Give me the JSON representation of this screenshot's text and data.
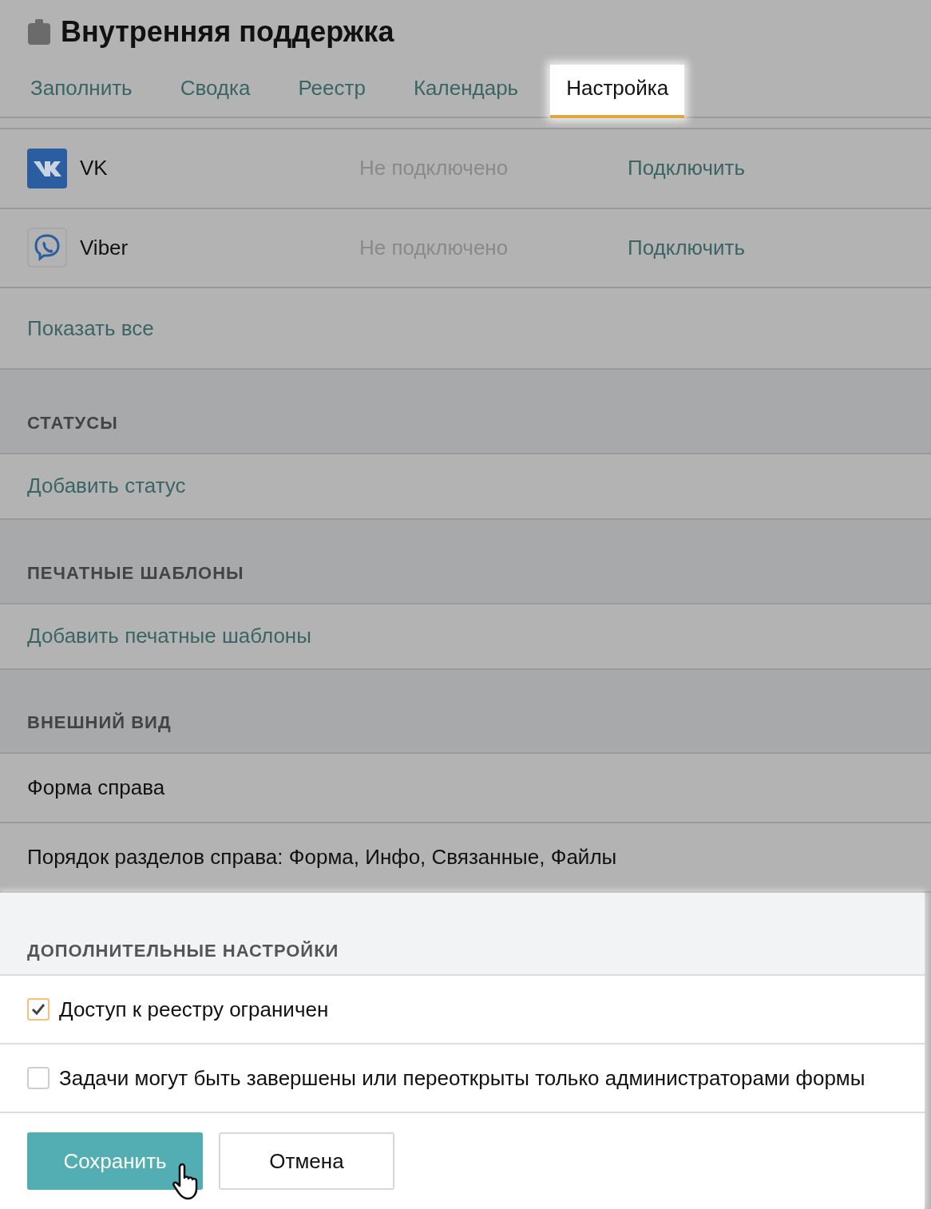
{
  "header": {
    "title": "Внутренняя поддержка"
  },
  "tabs": [
    {
      "label": "Заполнить",
      "selected": false
    },
    {
      "label": "Сводка",
      "selected": false
    },
    {
      "label": "Реестр",
      "selected": false
    },
    {
      "label": "Календарь",
      "selected": false
    },
    {
      "label": "Настройка",
      "selected": true
    }
  ],
  "integrations": [
    {
      "kind": "vk",
      "name": "VK",
      "status": "Не подключено",
      "action": "Подключить"
    },
    {
      "kind": "viber",
      "name": "Viber",
      "status": "Не подключено",
      "action": "Подключить"
    }
  ],
  "show_all": "Показать все",
  "sections": [
    {
      "title": "СТАТУСЫ",
      "items": [
        {
          "kind": "link",
          "text": "Добавить статус"
        }
      ]
    },
    {
      "title": "ПЕЧАТНЫЕ ШАБЛОНЫ",
      "items": [
        {
          "kind": "link",
          "text": "Добавить печатные шаблоны"
        }
      ]
    },
    {
      "title": "ВНЕШНИЙ ВИД",
      "items": [
        {
          "kind": "text",
          "text": "Форма справа"
        },
        {
          "kind": "text",
          "text": "Порядок разделов справа: Форма, Инфо, Связанные, Файлы"
        }
      ]
    }
  ],
  "extra_settings": {
    "title": "ДОПОЛНИТЕЛЬНЫЕ НАСТРОЙКИ",
    "options": [
      {
        "label": "Доступ к реестру ограничен",
        "checked": true
      },
      {
        "label": "Задачи могут быть завершены или переоткрыты только администраторами формы",
        "checked": false
      }
    ]
  },
  "buttons": [
    {
      "kind": "primary",
      "label": "Сохранить"
    },
    {
      "kind": "secondary",
      "label": "Отмена"
    }
  ]
}
